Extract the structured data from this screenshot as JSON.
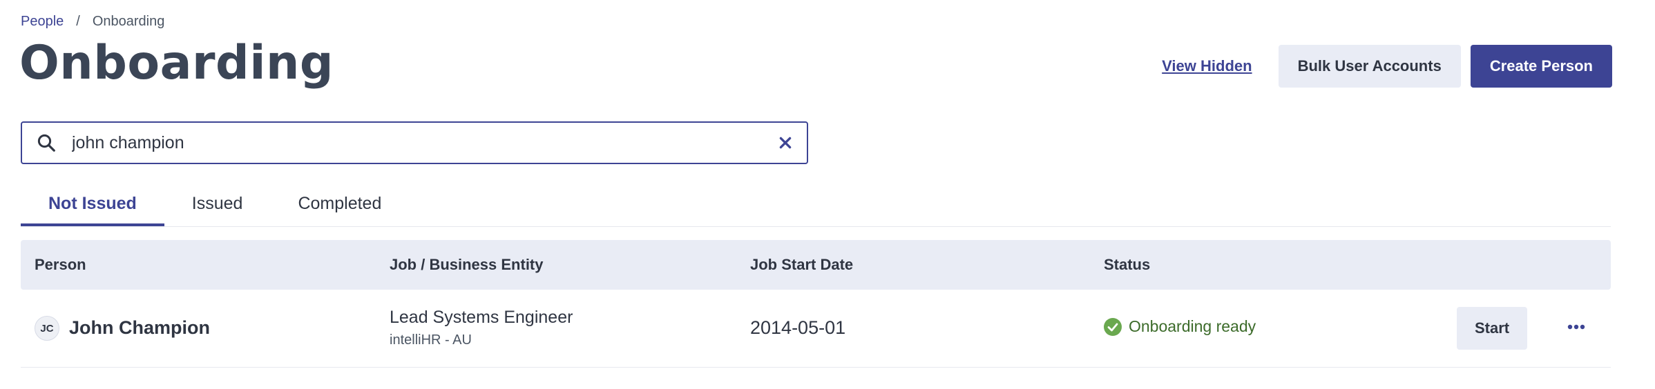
{
  "breadcrumb": {
    "parent": "People",
    "separator": "/",
    "current": "Onboarding"
  },
  "page": {
    "title": "Onboarding"
  },
  "actions": {
    "view_hidden": "View Hidden",
    "bulk_user_accounts": "Bulk User Accounts",
    "create_person": "Create Person"
  },
  "search": {
    "value": "john champion",
    "icon": "search-icon",
    "clear_icon": "close-icon"
  },
  "tabs": [
    {
      "label": "Not Issued",
      "active": true
    },
    {
      "label": "Issued",
      "active": false
    },
    {
      "label": "Completed",
      "active": false
    }
  ],
  "table": {
    "columns": [
      "Person",
      "Job / Business Entity",
      "Job Start Date",
      "Status"
    ],
    "rows": [
      {
        "initials": "JC",
        "name": "John Champion",
        "job_title": "Lead Systems Engineer",
        "business_entity": "intelliHR - AU",
        "start_date": "2014-05-01",
        "status": "Onboarding ready",
        "status_icon": "check-circle-icon",
        "action_label": "Start",
        "more_icon": "more-horizontal-icon"
      }
    ]
  },
  "colors": {
    "accent": "#3d4494",
    "header_bg": "#e9ecf5",
    "status_green": "#6aa84f",
    "status_text": "#3c6b2a"
  }
}
